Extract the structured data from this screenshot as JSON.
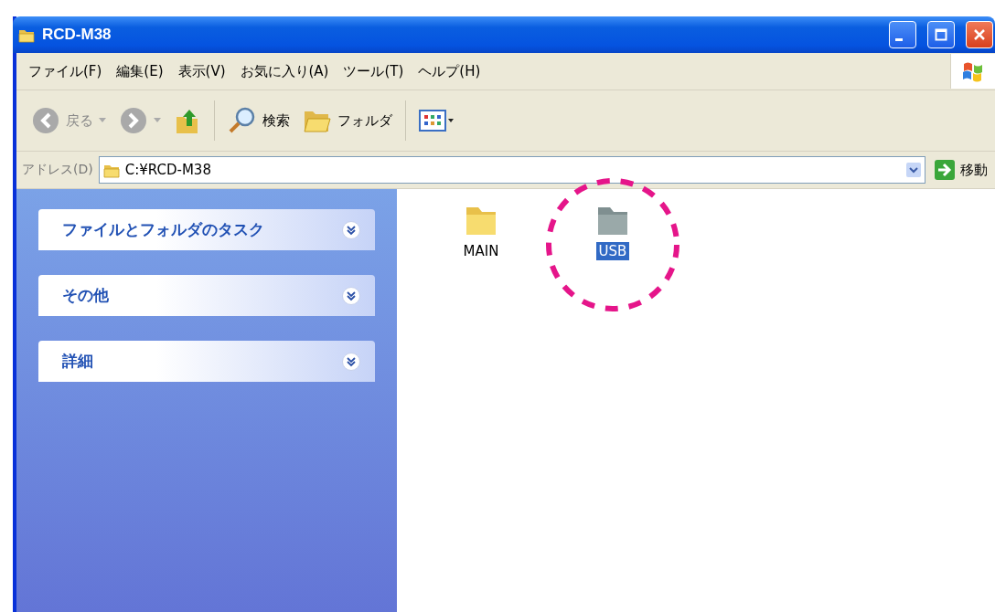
{
  "window": {
    "title": "RCD-M38"
  },
  "menu": [
    "ファイル(F)",
    "編集(E)",
    "表示(V)",
    "お気に入り(A)",
    "ツール(T)",
    "ヘルプ(H)"
  ],
  "toolbar": [
    {
      "kind": "back",
      "label": "戻る",
      "disabled": true
    },
    {
      "kind": "forward",
      "disabled": true
    },
    {
      "kind": "up",
      "disabled": false
    },
    {
      "kind": "search",
      "label": "検索",
      "disabled": false
    },
    {
      "kind": "folders",
      "label": "フォルダ",
      "disabled": false
    },
    {
      "kind": "views",
      "disabled": false
    }
  ],
  "address": {
    "label": "アドレス(D)",
    "value": "C:¥RCD-M38",
    "go": "移動"
  },
  "sidebar": {
    "panels": [
      {
        "title": "ファイルとフォルダのタスク",
        "expanded": false
      },
      {
        "title": "その他",
        "expanded": false
      },
      {
        "title": "詳細",
        "expanded": false
      }
    ]
  },
  "files": [
    {
      "name": "MAIN",
      "selected": false,
      "circled": false
    },
    {
      "name": "USB",
      "selected": true,
      "circled": true
    }
  ]
}
